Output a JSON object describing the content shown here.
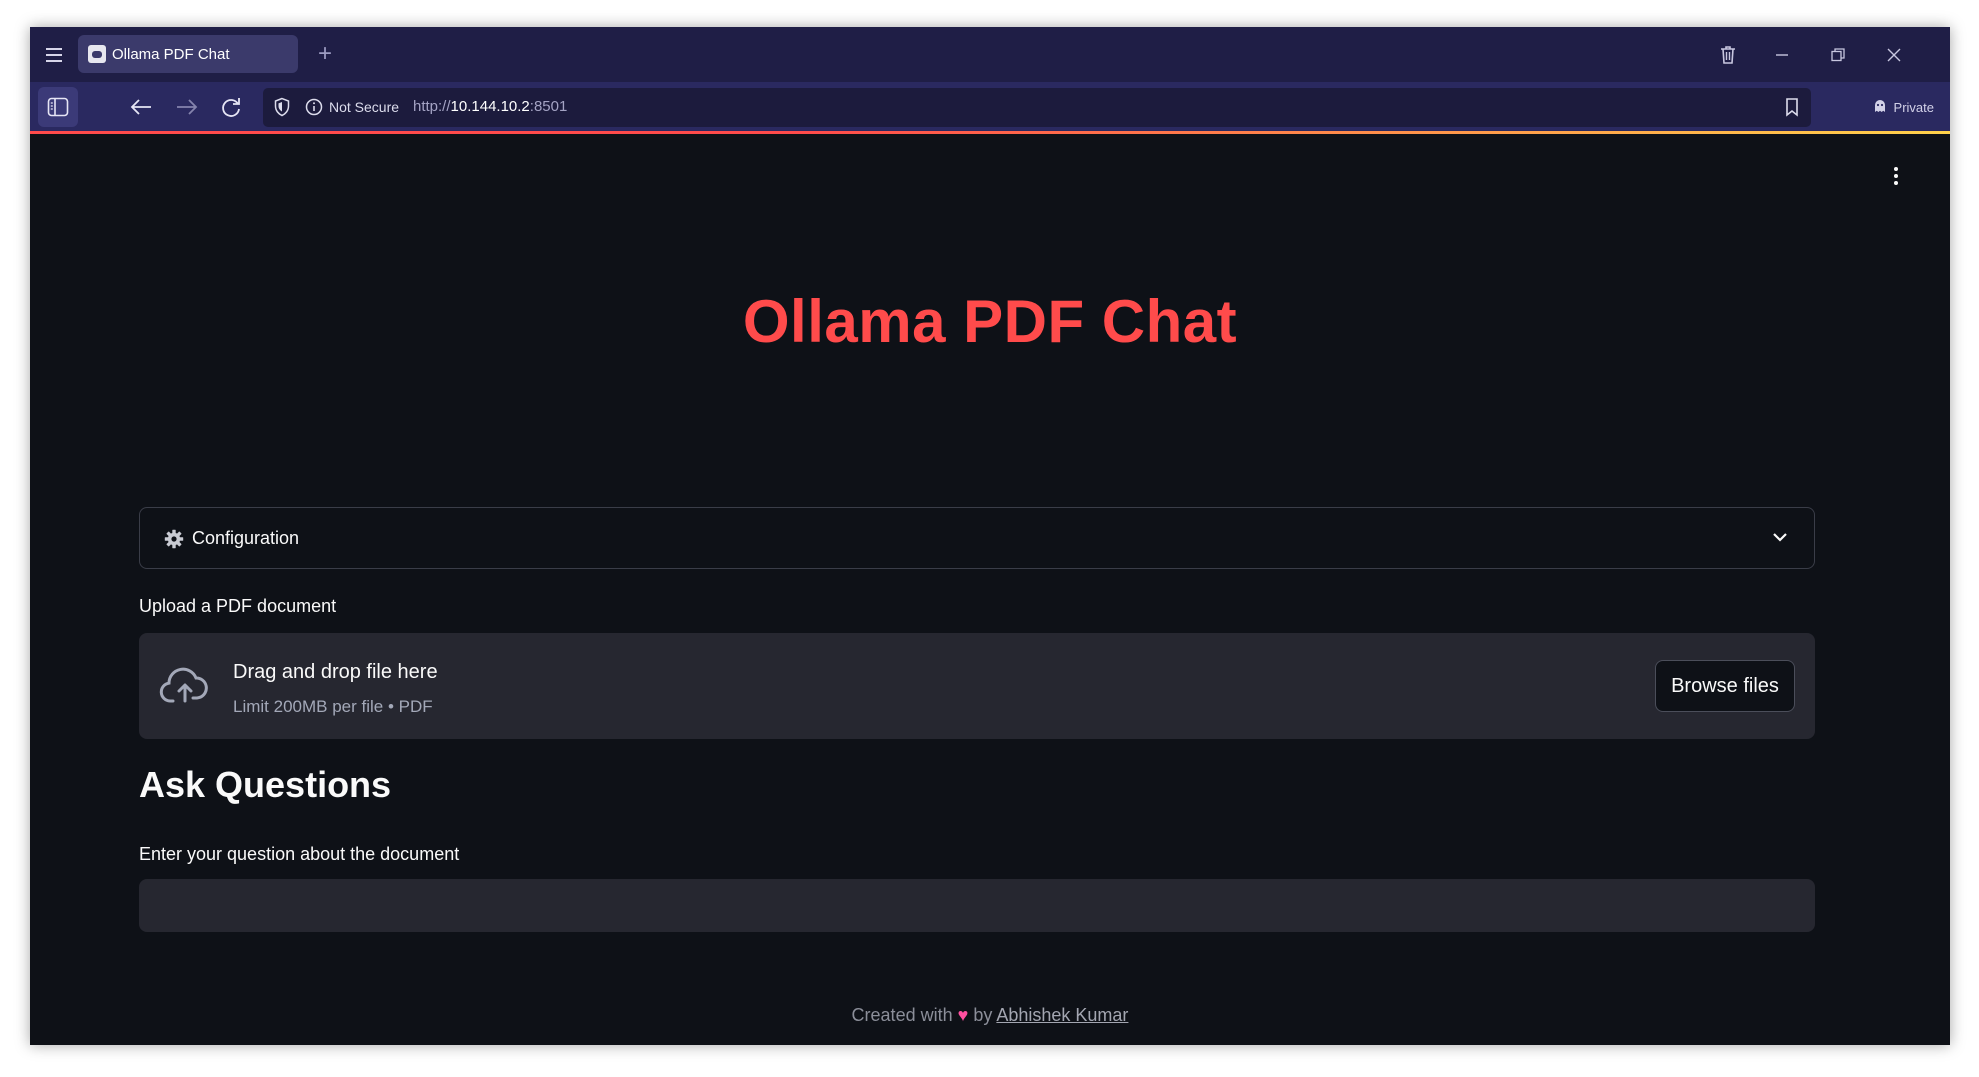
{
  "browser": {
    "tab_title": "Ollama PDF Chat",
    "new_tab_symbol": "+",
    "url_security": "Not Secure",
    "url_scheme": "http://",
    "url_host": "10.144.10.2",
    "url_port": ":8501",
    "private_label": "Private"
  },
  "app": {
    "title": "Ollama PDF Chat",
    "config_label": "Configuration",
    "upload_label": "Upload a PDF document",
    "dropzone_title": "Drag and drop file here",
    "dropzone_limit": "Limit 200MB per file • PDF",
    "browse_label": "Browse files",
    "ask_heading": "Ask Questions",
    "question_label": "Enter your question about the document",
    "question_value": "",
    "footer_prefix": "Created with",
    "footer_heart": "♥",
    "footer_by": "by",
    "footer_author": "Abhishek Kumar"
  },
  "colors": {
    "accent": "#ff4b4b",
    "app_background": "#0e1117",
    "widget_background": "#262730",
    "tabstrip": "#1f1e46",
    "toolbar": "#2a2960"
  },
  "icons": [
    "menu-icon",
    "app-favicon-icon",
    "trash-icon",
    "minimize-icon",
    "restore-icon",
    "close-icon",
    "sidebar-icon",
    "back-icon",
    "forward-icon",
    "reload-icon",
    "shield-icon",
    "info-icon",
    "bookmark-icon",
    "private-icon",
    "kebab-menu-icon",
    "gear-icon",
    "chevron-down-icon",
    "cloud-upload-icon",
    "heart-icon"
  ]
}
